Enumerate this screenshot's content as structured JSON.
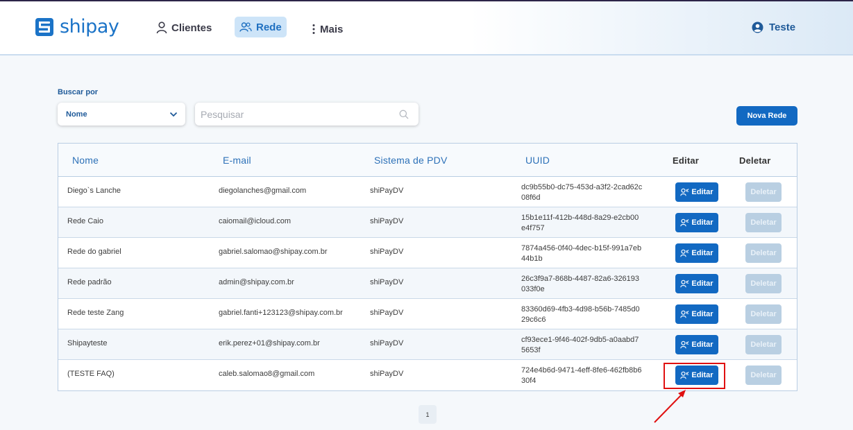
{
  "brand": {
    "name": "shipay",
    "color": "#1b73c7"
  },
  "nav": {
    "clientes": "Clientes",
    "rede": "Rede",
    "mais": "Mais",
    "user": "Teste"
  },
  "filters": {
    "search_by_label": "Buscar por",
    "select_value": "Nome",
    "search_placeholder": "Pesquisar",
    "new_button": "Nova Rede"
  },
  "table": {
    "headers": {
      "name": "Nome",
      "email": "E-mail",
      "pdv": "Sistema de PDV",
      "uuid": "UUID",
      "edit": "Editar",
      "delete": "Deletar"
    },
    "edit_label": "Editar",
    "delete_label": "Deletar",
    "rows": [
      {
        "name": "Diego`s Lanche",
        "email": "diegolanches@gmail.com",
        "pdv": "shiPayDV",
        "uuid": "dc9b55b0-dc75-453d-a3f2-2cad62c08f6d"
      },
      {
        "name": "Rede Caio",
        "email": "caiomail@icloud.com",
        "pdv": "shiPayDV",
        "uuid": "15b1e11f-412b-448d-8a29-e2cb00e4f757"
      },
      {
        "name": "Rede do gabriel",
        "email": "gabriel.salomao@shipay.com.br",
        "pdv": "shiPayDV",
        "uuid": "7874a456-0f40-4dec-b15f-991a7eb44b1b"
      },
      {
        "name": "Rede padrão",
        "email": "admin@shipay.com.br",
        "pdv": "shiPayDV",
        "uuid": "26c3f9a7-868b-4487-82a6-326193033f0e"
      },
      {
        "name": "Rede teste Zang",
        "email": "gabriel.fanti+123123@shipay.com.br",
        "pdv": "shiPayDV",
        "uuid": "83360d69-4fb3-4d98-b56b-7485d029c6c6"
      },
      {
        "name": "Shipayteste",
        "email": "erik.perez+01@shipay.com.br",
        "pdv": "shiPayDV",
        "uuid": "cf93ece1-9f46-402f-9db5-a0aabd75653f"
      },
      {
        "name": "(TESTE FAQ)",
        "email": "caleb.salomao8@gmail.com",
        "pdv": "shiPayDV",
        "uuid": "724e4b6d-9471-4eff-8fe6-462fb8b630f4"
      }
    ]
  },
  "pagination": {
    "current": "1"
  },
  "colors": {
    "primary": "#1269c2",
    "disabled": "#b9cfe2",
    "annotation": "#e01010"
  },
  "icons": {
    "clientes": "person-icon",
    "rede": "people-icon",
    "mais": "vertical-dots-icon",
    "user": "user-circle-icon",
    "select": "chevron-down-icon",
    "search": "search-icon",
    "edit": "user-edit-icon"
  }
}
